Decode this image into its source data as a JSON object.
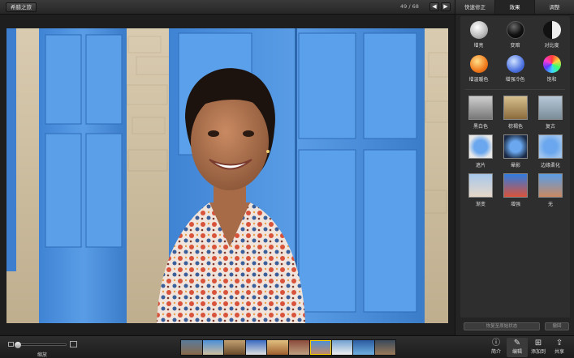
{
  "topbar": {
    "back_label": "希腊之旅",
    "counter": "49 / 68",
    "prev_glyph": "◀",
    "next_glyph": "▶"
  },
  "panel": {
    "tabs": [
      {
        "label": "快速修正",
        "active": false
      },
      {
        "label": "效果",
        "active": true
      },
      {
        "label": "调整",
        "active": false
      }
    ],
    "circle_effects": [
      {
        "label": "增亮"
      },
      {
        "label": "变暗"
      },
      {
        "label": "对比度"
      },
      {
        "label": "增温暖色"
      },
      {
        "label": "增强冷色"
      },
      {
        "label": "饱和"
      }
    ],
    "thumb_effects": [
      {
        "label": "黑白色"
      },
      {
        "label": "棕褐色"
      },
      {
        "label": "复古"
      },
      {
        "label": "遮片"
      },
      {
        "label": "晕影"
      },
      {
        "label": "边缘柔化"
      },
      {
        "label": "渐变"
      },
      {
        "label": "增强"
      },
      {
        "label": "无"
      }
    ],
    "restore_label": "恢复至原始状态",
    "undo_label": "撤回"
  },
  "bottombar": {
    "zoom_label": "缩放",
    "tools": [
      {
        "label": "简介",
        "icon": "info-icon",
        "glyph": "ⓘ",
        "active": false
      },
      {
        "label": "编辑",
        "icon": "pencil-icon",
        "glyph": "✎",
        "active": true
      },
      {
        "label": "添加到",
        "icon": "add-icon",
        "glyph": "⊞",
        "active": false
      },
      {
        "label": "共享",
        "icon": "share-icon",
        "glyph": "⇪",
        "active": false
      }
    ]
  },
  "colors": {
    "selection": "#ffd400",
    "panel_bg": "#2e2e2e",
    "door_blue": "#4a8fd8"
  }
}
